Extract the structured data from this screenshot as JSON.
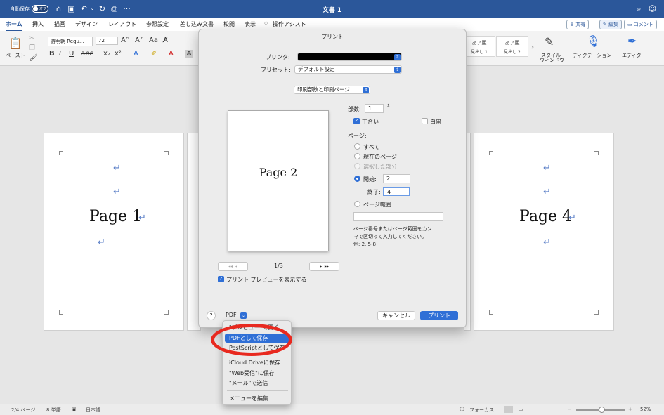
{
  "titlebar": {
    "autosave_label": "自動保存",
    "autosave_state": "オフ",
    "doc_title": "文書 1"
  },
  "menubar": {
    "tabs": [
      "ホーム",
      "挿入",
      "描画",
      "デザイン",
      "レイアウト",
      "参照設定",
      "差し込み文書",
      "校閲",
      "表示"
    ],
    "assist": "操作アシスト",
    "share": "共有",
    "edit": "編集",
    "comment": "コメント"
  },
  "ribbon": {
    "paste": "ペースト",
    "font_name": "游明朝 Regu...",
    "font_size": "72",
    "style1_preview": "あア亜",
    "style1_name": "見出し 1",
    "style2_preview": "あア亜",
    "style2_name": "見出し 2",
    "style_window": "スタイル\nウィンドウ",
    "style_window_l1": "スタイル",
    "style_window_l2": "ウィンドウ",
    "dictation": "ディクテーション",
    "editor": "エディター"
  },
  "pages": {
    "page1": "Page 1",
    "page4": "Page 4"
  },
  "dialog": {
    "title": "プリント",
    "printer_label": "プリンタ:",
    "preset_label": "プリセット:",
    "preset_value": "デフォルト設定",
    "section_value": "印刷部数と印刷ページ",
    "preview_text": "Page 2",
    "copies_label": "部数:",
    "copies_value": "1",
    "collate_label": "丁合い",
    "bw_label": "白黒",
    "pages_label": "ページ:",
    "opt_all": "すべて",
    "opt_current": "現在のページ",
    "opt_selection": "選択した部分",
    "opt_from": "開始:",
    "from_value": "2",
    "to_label": "終了:",
    "to_value": "4",
    "opt_range": "ページ範囲",
    "range_hint": "ページ番号またはページ範囲をカンマで区切って入力してください。例: 2, 5-8",
    "range_hint_l1": "ページ番号またはページ範囲をカン",
    "range_hint_l2": "マで区切って入力してください。",
    "range_hint_l3": "例: 2, 5-8",
    "page_indicator": "1/3",
    "show_preview": "プリント プレビューを表示する",
    "help": "?",
    "pdf_label": "PDF",
    "cancel": "キャンセル",
    "print": "プリント"
  },
  "pdf_menu": {
    "items": [
      "\"プレビュー\"で開く",
      "PDFとして保存",
      "PostScriptとして保存",
      "iCloud Driveに保存",
      "\"Web受信\"に保存",
      "\"メール\"で送信",
      "メニューを編集..."
    ],
    "selected_index": 1
  },
  "statusbar": {
    "pages": "2/4 ページ",
    "words": "8 単語",
    "language": "日本語",
    "focus": "フォーカス",
    "zoom": "52%",
    "zoom_level": 0.52
  },
  "colors": {
    "brand": "#2b579a",
    "accent": "#2f6fd6",
    "highlight": "#e8291f"
  }
}
